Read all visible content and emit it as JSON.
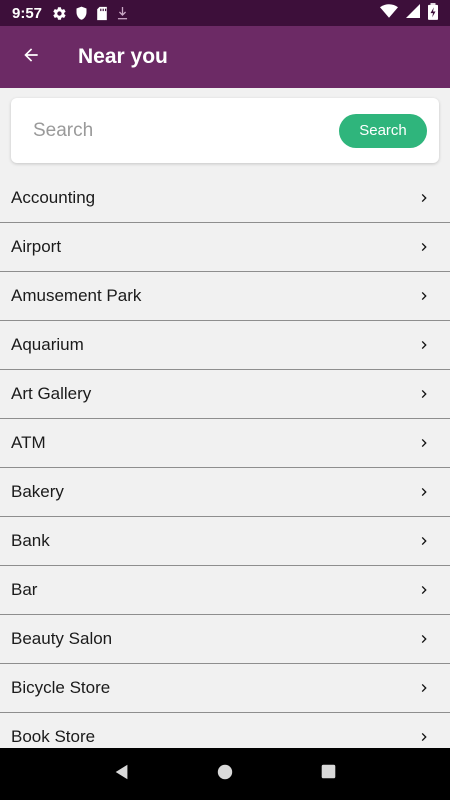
{
  "status_bar": {
    "time": "9:57",
    "left_icons": [
      "gear-icon",
      "shield-icon",
      "sd-card-icon",
      "download-icon"
    ],
    "right_icons": [
      "wifi-icon",
      "signal-icon",
      "battery-icon"
    ]
  },
  "app_bar": {
    "title": "Near you",
    "back_icon": "arrow-left-icon"
  },
  "search": {
    "placeholder": "Search",
    "value": "",
    "button_label": "Search"
  },
  "categories": [
    {
      "label": "Accounting"
    },
    {
      "label": "Airport"
    },
    {
      "label": "Amusement Park"
    },
    {
      "label": "Aquarium"
    },
    {
      "label": "Art Gallery"
    },
    {
      "label": "ATM"
    },
    {
      "label": "Bakery"
    },
    {
      "label": "Bank"
    },
    {
      "label": "Bar"
    },
    {
      "label": "Beauty Salon"
    },
    {
      "label": "Bicycle Store"
    },
    {
      "label": "Book Store"
    }
  ],
  "colors": {
    "status_bar": "#3d0f3a",
    "app_bar": "#6c2a65",
    "accent_button": "#2fb57c",
    "background": "#f1f1f1"
  }
}
